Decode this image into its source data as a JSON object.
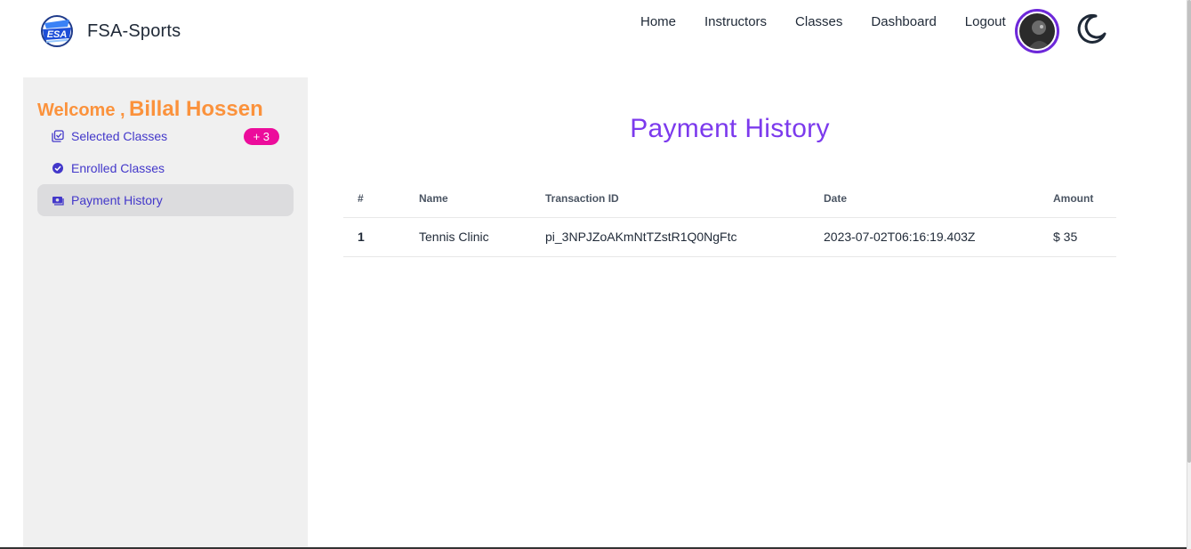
{
  "navbar": {
    "brand_name": "FSA-Sports",
    "logo_icon": "fsa-logo-icon",
    "links": [
      "Home",
      "Instructors",
      "Classes",
      "Dashboard",
      "Logout"
    ],
    "avatar_icon": "user-avatar",
    "theme_icon": "moon-icon"
  },
  "sidebar": {
    "welcome_label": "Welcome ,",
    "user_name": "Billal Hossen",
    "items": [
      {
        "label": "Selected Classes",
        "icon": "selected-classes-icon",
        "badge": "+ 3"
      },
      {
        "label": "Enrolled Classes",
        "icon": "check-circle-icon"
      },
      {
        "label": "Payment History",
        "icon": "payment-icon",
        "active": true
      }
    ]
  },
  "main": {
    "title": "Payment History",
    "table": {
      "headers": [
        "#",
        "Name",
        "Transaction ID",
        "Date",
        "Amount"
      ],
      "rows": [
        [
          "1",
          "Tennis Clinic",
          "pi_3NPJZoAKmNtTZstR1Q0NgFtc",
          "2023-07-02T06:16:19.403Z",
          "$ 35"
        ]
      ]
    }
  },
  "colors": {
    "accent_purple": "#7c3aed",
    "welcome_orange": "#fb923c",
    "menu_text": "#4338ca",
    "badge_pink": "#ec0c9b"
  }
}
